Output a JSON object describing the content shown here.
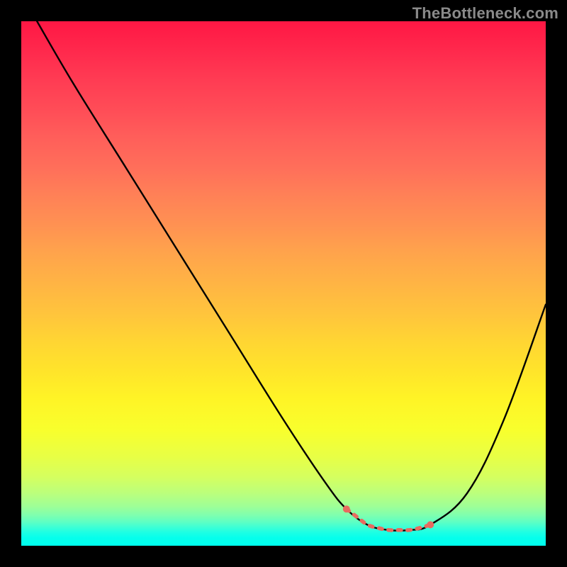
{
  "watermark": "TheBottleneck.com",
  "chart_data": {
    "type": "line",
    "title": "",
    "xlabel": "",
    "ylabel": "",
    "xlim": [
      0,
      100
    ],
    "ylim": [
      0,
      100
    ],
    "grid": false,
    "legend": false,
    "series": [
      {
        "name": "bottleneck-curve",
        "color": "#000000",
        "x": [
          3,
          10,
          20,
          30,
          40,
          50,
          58,
          62,
          66,
          70,
          74,
          78,
          85,
          92,
          100
        ],
        "y": [
          100,
          88,
          72,
          56,
          40,
          24,
          12,
          7,
          4,
          3,
          3,
          4,
          10,
          24,
          46
        ]
      }
    ],
    "markers": [
      {
        "name": "valley-left-dot",
        "x": 62,
        "y": 7,
        "color": "#e86a5f",
        "r": 5
      },
      {
        "name": "valley-right-dot",
        "x": 78,
        "y": 4,
        "color": "#e86a5f",
        "r": 5
      }
    ],
    "valley_band": {
      "name": "valley-dash",
      "color": "#e86a5f",
      "x": [
        62,
        64,
        66,
        68,
        70,
        72,
        74,
        76,
        78
      ],
      "y": [
        7,
        5.5,
        4,
        3.4,
        3,
        3,
        3,
        3.4,
        4
      ]
    },
    "background": {
      "type": "vertical-gradient",
      "stops": [
        {
          "pos": 0,
          "color": "#ff1744"
        },
        {
          "pos": 50,
          "color": "#ffb444"
        },
        {
          "pos": 78,
          "color": "#e8ff45"
        },
        {
          "pos": 100,
          "color": "#00ffee"
        }
      ]
    }
  }
}
